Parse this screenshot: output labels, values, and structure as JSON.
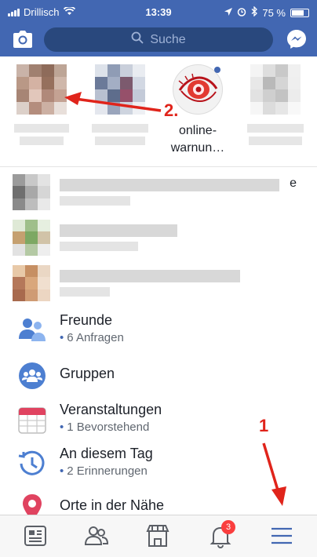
{
  "status_bar": {
    "carrier": "Drillisch",
    "time": "13:39",
    "battery": "75 %"
  },
  "header": {
    "search_placeholder": "Suche",
    "icons": [
      "camera-icon",
      "search-icon",
      "messenger-icon"
    ]
  },
  "stories": [
    {
      "name": "",
      "blurred": true
    },
    {
      "name": "",
      "blurred": true
    },
    {
      "name": "online-warnun…",
      "blurred": false,
      "online": true
    },
    {
      "name": "",
      "blurred": true
    }
  ],
  "blurred_rows": [
    {
      "trailing": "e"
    },
    {
      "trailing": ""
    },
    {
      "trailing": ""
    }
  ],
  "menu": [
    {
      "label": "Freunde",
      "sub": "6 Anfragen",
      "icon": "friends-icon"
    },
    {
      "label": "Gruppen",
      "sub": "",
      "icon": "groups-icon"
    },
    {
      "label": "Veranstaltungen",
      "sub": "1 Bevorstehend",
      "icon": "calendar-icon"
    },
    {
      "label": "An diesem Tag",
      "sub": "2 Erinnerungen",
      "icon": "memories-icon"
    },
    {
      "label": "Orte in der Nähe",
      "sub": "",
      "icon": "location-pin-icon"
    }
  ],
  "tabbar": {
    "icons": [
      "news-feed-icon",
      "friends-tab-icon",
      "marketplace-icon",
      "notifications-icon",
      "menu-icon"
    ],
    "notification_count": "3"
  },
  "annotations": {
    "step1": "1",
    "step2": "2."
  },
  "colors": {
    "brand": "#4267b2",
    "annotation": "#e0241b",
    "badge": "#fa3e3e"
  }
}
